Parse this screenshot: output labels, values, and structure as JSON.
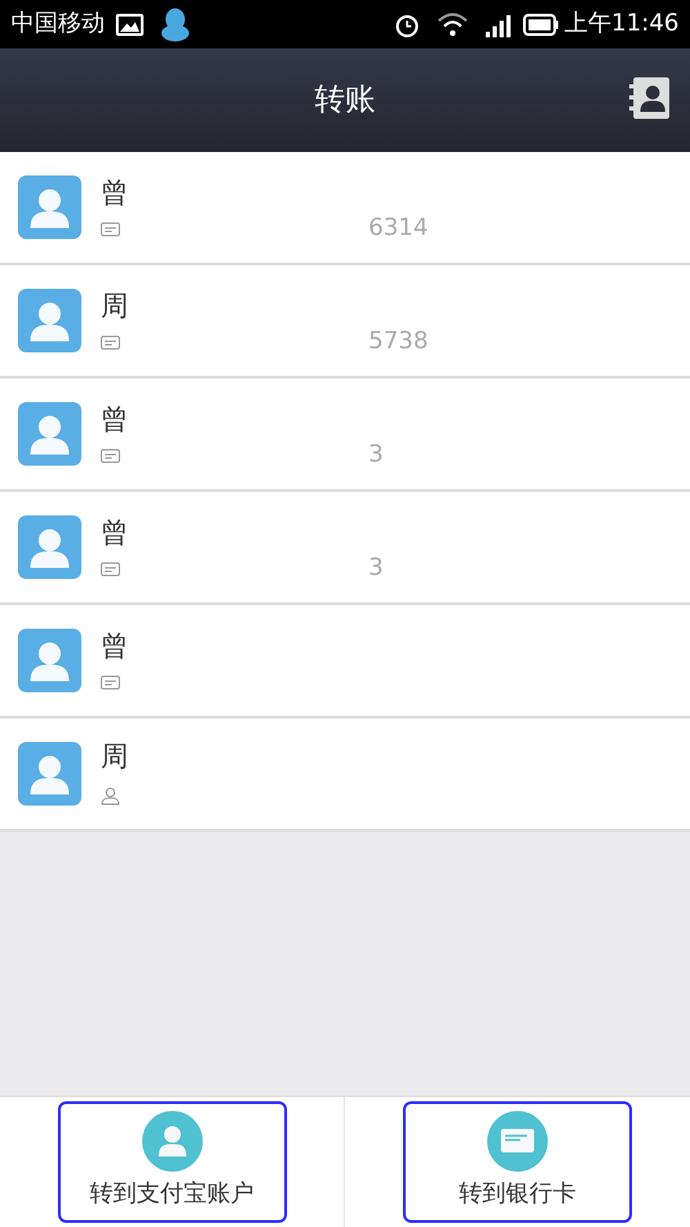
{
  "status_bar": {
    "carrier": "中国移动",
    "time": "上午11:46"
  },
  "header": {
    "title": "转账"
  },
  "contacts": [
    {
      "name": "曾",
      "kind": "card",
      "account": "6314"
    },
    {
      "name": "周",
      "kind": "card",
      "account": "5738"
    },
    {
      "name": "曾",
      "kind": "card",
      "account": "3"
    },
    {
      "name": "曾",
      "kind": "card",
      "account": "3"
    },
    {
      "name": "曾",
      "kind": "card"
    },
    {
      "name": "周",
      "kind": "person"
    }
  ],
  "actions": [
    {
      "label": "转到支付宝账户",
      "kind": "account"
    },
    {
      "label": "转到银行卡",
      "kind": "card"
    }
  ]
}
